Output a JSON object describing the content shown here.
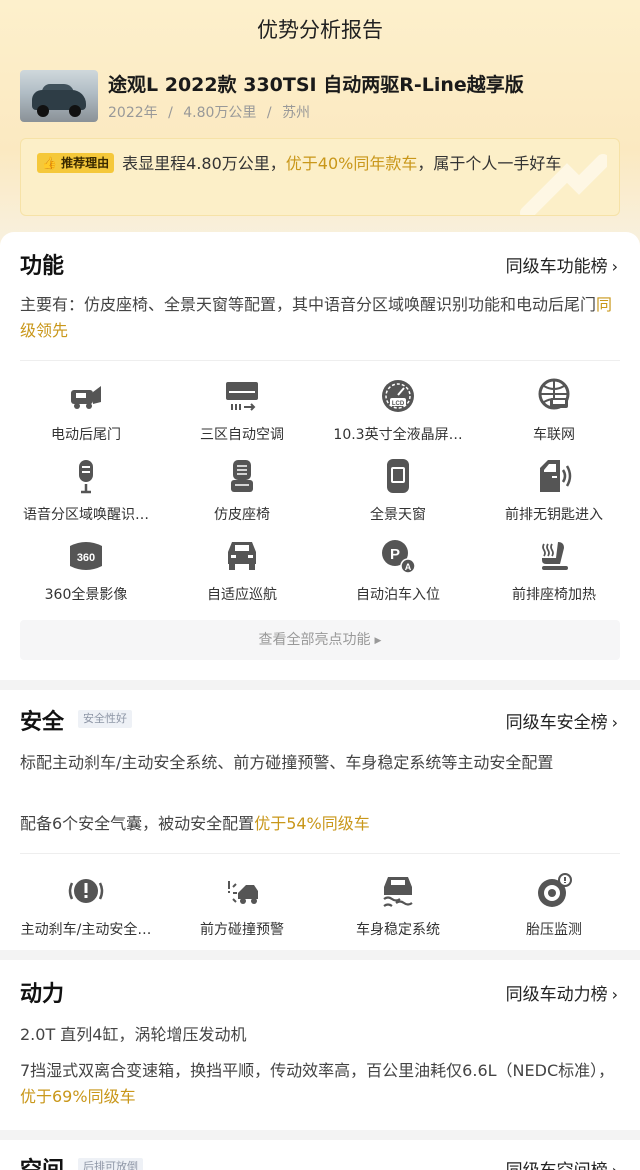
{
  "page_title": "优势分析报告",
  "car": {
    "name": "途观L 2022款 330TSI 自动两驱R-Line越享版",
    "year": "2022年",
    "mileage": "4.80万公里",
    "city": "苏州",
    "sep": "/"
  },
  "reason": {
    "badge": "推荐理由",
    "text_pre": "表显里程4.80万公里，",
    "text_hl": "优于40%同年款车",
    "text_post": "，属于个人一手好车"
  },
  "function": {
    "title": "功能",
    "rank": "同级车功能榜",
    "desc_pre": "主要有：仿皮座椅、全景天窗等配置，其中语音分区域唤醒识别功能和电动后尾门",
    "desc_hl": "同级领先",
    "features": [
      {
        "label": "电动后尾门",
        "icon": "tailgate-icon"
      },
      {
        "label": "三区自动空调",
        "icon": "air-conditioner-icon"
      },
      {
        "label": "10.3英寸全液晶屏…",
        "icon": "lcd-gauge-icon"
      },
      {
        "label": "车联网",
        "icon": "connected-car-icon"
      },
      {
        "label": "语音分区域唤醒识…",
        "icon": "microphone-icon"
      },
      {
        "label": "仿皮座椅",
        "icon": "seat-icon"
      },
      {
        "label": "全景天窗",
        "icon": "sunroof-icon"
      },
      {
        "label": "前排无钥匙进入",
        "icon": "keyless-door-icon"
      },
      {
        "label": "360全景影像",
        "icon": "camera-360-icon"
      },
      {
        "label": "自适应巡航",
        "icon": "cruise-icon"
      },
      {
        "label": "自动泊车入位",
        "icon": "auto-parking-icon"
      },
      {
        "label": "前排座椅加热",
        "icon": "seat-heating-icon"
      }
    ],
    "view_all": "查看全部亮点功能"
  },
  "safety": {
    "title": "安全",
    "tag": "安全性好",
    "rank": "同级车安全榜",
    "desc1": "标配主动刹车/主动安全系统、前方碰撞预警、车身稳定系统等主动安全配置",
    "desc2_pre": "配备6个安全气囊，被动安全配置",
    "desc2_hl": "优于54%同级车",
    "features": [
      {
        "label": "主动刹车/主动安全…",
        "icon": "brake-warning-icon"
      },
      {
        "label": "前方碰撞预警",
        "icon": "collision-warning-icon"
      },
      {
        "label": "车身稳定系统",
        "icon": "stability-icon"
      },
      {
        "label": "胎压监测",
        "icon": "tire-pressure-icon"
      }
    ]
  },
  "power": {
    "title": "动力",
    "rank": "同级车动力榜",
    "desc1": "2.0T 直列4缸，涡轮增压发动机",
    "desc2_pre": "7挡湿式双离合变速箱，换挡平顺，传动效率高，百公里油耗仅6.6L（NEDC标准），",
    "desc2_hl": "优于69%同级车"
  },
  "space": {
    "title": "空间",
    "tag": "后排可放倒",
    "rank": "同级车空间榜"
  },
  "colors": {
    "accent": "#c9971a",
    "badge": "#f5c83a",
    "top_bg": "#fdf0cc"
  }
}
